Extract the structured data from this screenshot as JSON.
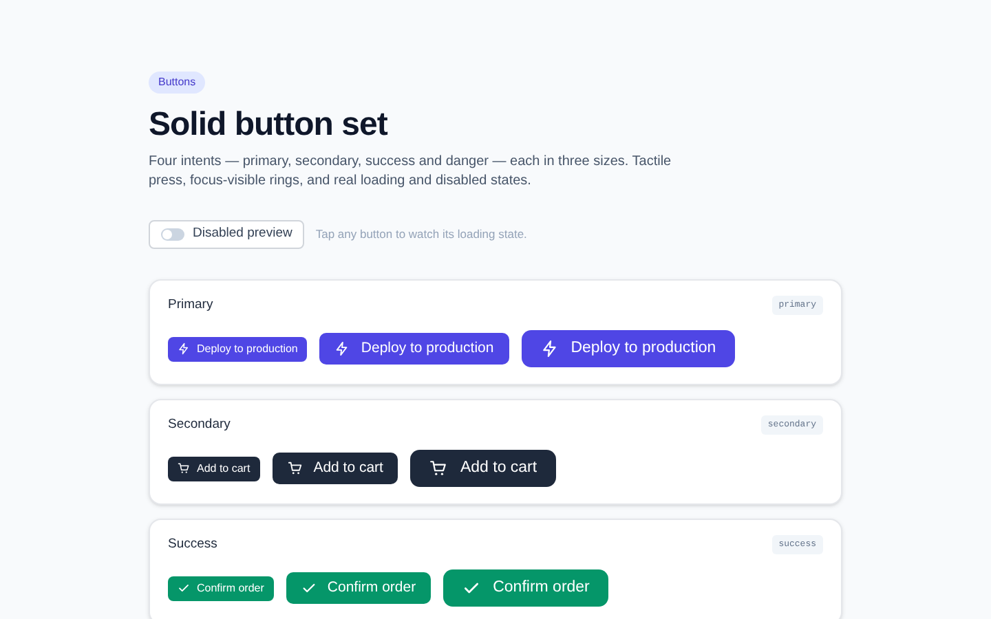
{
  "badge": "Buttons",
  "title": "Solid button set",
  "description": "Four intents — primary, secondary, success and danger — each in three sizes. Tactile press, focus-visible rings, and real loading and disabled states.",
  "toggle": {
    "label": "Disabled preview",
    "on": false
  },
  "hint": "Tap any button to watch its loading state.",
  "sections": [
    {
      "title": "Primary",
      "tag": "primary",
      "kind": "primary",
      "buttons": [
        "Deploy to production",
        "Deploy to production",
        "Deploy to production"
      ]
    },
    {
      "title": "Secondary",
      "tag": "secondary",
      "kind": "secondary",
      "buttons": [
        "Add to cart",
        "Add to cart",
        "Add to cart"
      ]
    },
    {
      "title": "Success",
      "tag": "success",
      "kind": "success",
      "buttons": [
        "Confirm order",
        "Confirm order",
        "Confirm order"
      ]
    }
  ]
}
